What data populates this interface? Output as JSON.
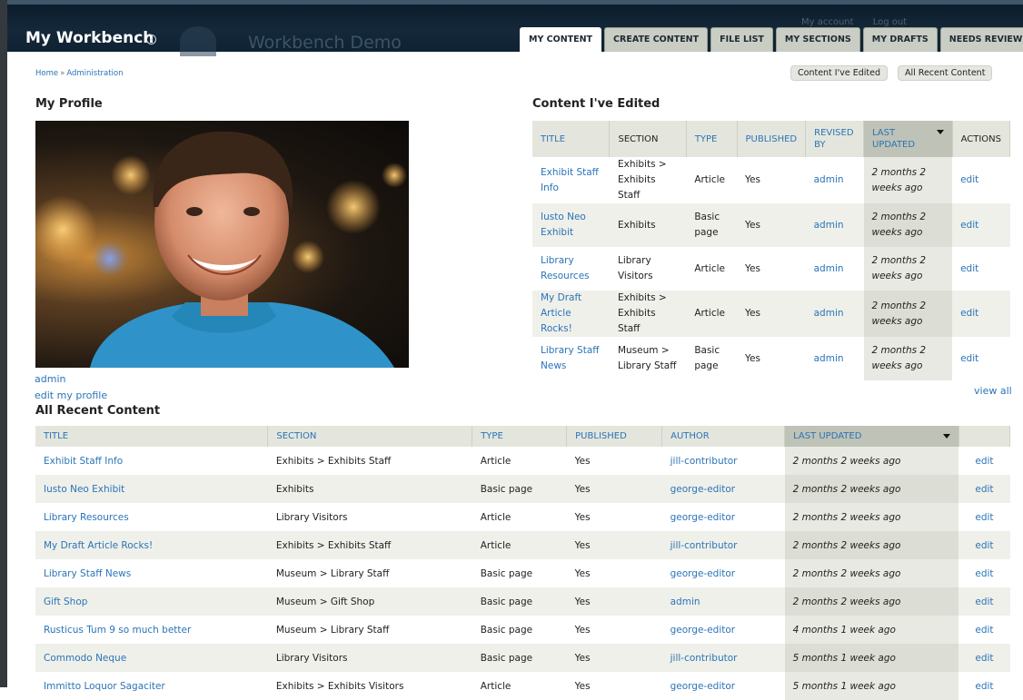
{
  "header": {
    "site_title": "My Workbench",
    "site_name": "Workbench Demo",
    "my_account": "My account",
    "log_out": "Log out"
  },
  "tabs": [
    {
      "label": "MY CONTENT",
      "active": true
    },
    {
      "label": "CREATE CONTENT",
      "active": false
    },
    {
      "label": "FILE LIST",
      "active": false
    },
    {
      "label": "MY SECTIONS",
      "active": false
    },
    {
      "label": "MY DRAFTS",
      "active": false
    },
    {
      "label": "NEEDS REVIEW",
      "active": false
    }
  ],
  "breadcrumb": {
    "home": "Home",
    "separator": "»",
    "admin": "Administration"
  },
  "toggles": {
    "edited": "Content I've Edited",
    "recent": "All Recent Content"
  },
  "profile": {
    "heading": "My Profile",
    "name": "admin",
    "edit_link": "edit my profile"
  },
  "edited": {
    "heading": "Content I've Edited",
    "columns": [
      "TITLE",
      "SECTION",
      "TYPE",
      "PUBLISHED",
      "REVISED BY",
      "LAST UPDATED",
      "ACTIONS"
    ],
    "rows": [
      {
        "title": "Exhibit Staff Info",
        "section": "Exhibits > Exhibits Staff",
        "type": "Article",
        "published": "Yes",
        "revised_by": "admin",
        "updated": "2 months 2 weeks ago",
        "action": "edit"
      },
      {
        "title": "Iusto Neo Exhibit",
        "section": "Exhibits",
        "type": "Basic page",
        "published": "Yes",
        "revised_by": "admin",
        "updated": "2 months 2 weeks ago",
        "action": "edit"
      },
      {
        "title": "Library Resources",
        "section": "Library Visitors",
        "type": "Article",
        "published": "Yes",
        "revised_by": "admin",
        "updated": "2 months 2 weeks ago",
        "action": "edit"
      },
      {
        "title": "My Draft Article Rocks!",
        "section": "Exhibits > Exhibits Staff",
        "type": "Article",
        "published": "Yes",
        "revised_by": "admin",
        "updated": "2 months 2 weeks ago",
        "action": "edit"
      },
      {
        "title": "Library Staff News",
        "section": "Museum > Library Staff",
        "type": "Basic page",
        "published": "Yes",
        "revised_by": "admin",
        "updated": "2 months 2 weeks ago",
        "action": "edit"
      }
    ],
    "view_all": "view all"
  },
  "recent": {
    "heading": "All Recent Content",
    "columns": [
      "TITLE",
      "SECTION",
      "TYPE",
      "PUBLISHED",
      "AUTHOR",
      "LAST UPDATED",
      ""
    ],
    "rows": [
      {
        "title": "Exhibit Staff Info",
        "section": "Exhibits > Exhibits Staff",
        "type": "Article",
        "published": "Yes",
        "author": "jill-contributor",
        "updated": "2 months 2 weeks ago",
        "action": "edit"
      },
      {
        "title": "Iusto Neo Exhibit",
        "section": "Exhibits",
        "type": "Basic page",
        "published": "Yes",
        "author": "george-editor",
        "updated": "2 months 2 weeks ago",
        "action": "edit"
      },
      {
        "title": "Library Resources",
        "section": "Library Visitors",
        "type": "Article",
        "published": "Yes",
        "author": "george-editor",
        "updated": "2 months 2 weeks ago",
        "action": "edit"
      },
      {
        "title": "My Draft Article Rocks!",
        "section": "Exhibits > Exhibits Staff",
        "type": "Article",
        "published": "Yes",
        "author": "jill-contributor",
        "updated": "2 months 2 weeks ago",
        "action": "edit"
      },
      {
        "title": "Library Staff News",
        "section": "Museum > Library Staff",
        "type": "Basic page",
        "published": "Yes",
        "author": "george-editor",
        "updated": "2 months 2 weeks ago",
        "action": "edit"
      },
      {
        "title": "Gift Shop",
        "section": "Museum > Gift Shop",
        "type": "Basic page",
        "published": "Yes",
        "author": "admin",
        "updated": "2 months 2 weeks ago",
        "action": "edit"
      },
      {
        "title": "Rusticus Tum 9 so much better",
        "section": "Museum > Library Staff",
        "type": "Basic page",
        "published": "Yes",
        "author": "george-editor",
        "updated": "4 months 1 week ago",
        "action": "edit"
      },
      {
        "title": "Commodo Neque",
        "section": "Library Visitors",
        "type": "Basic page",
        "published": "Yes",
        "author": "jill-contributor",
        "updated": "5 months 1 week ago",
        "action": "edit"
      },
      {
        "title": "Immitto Loquor Sagaciter",
        "section": "Exhibits > Exhibits Visitors",
        "type": "Article",
        "published": "Yes",
        "author": "george-editor",
        "updated": "5 months 1 week ago",
        "action": "edit"
      }
    ]
  },
  "colors": {
    "link": "#2a74b8",
    "header_bg": "#14283a",
    "tab_bg": "#c9cdc4",
    "row_alt": "#eff0ea",
    "sorted_header": "#bfc2b6"
  }
}
